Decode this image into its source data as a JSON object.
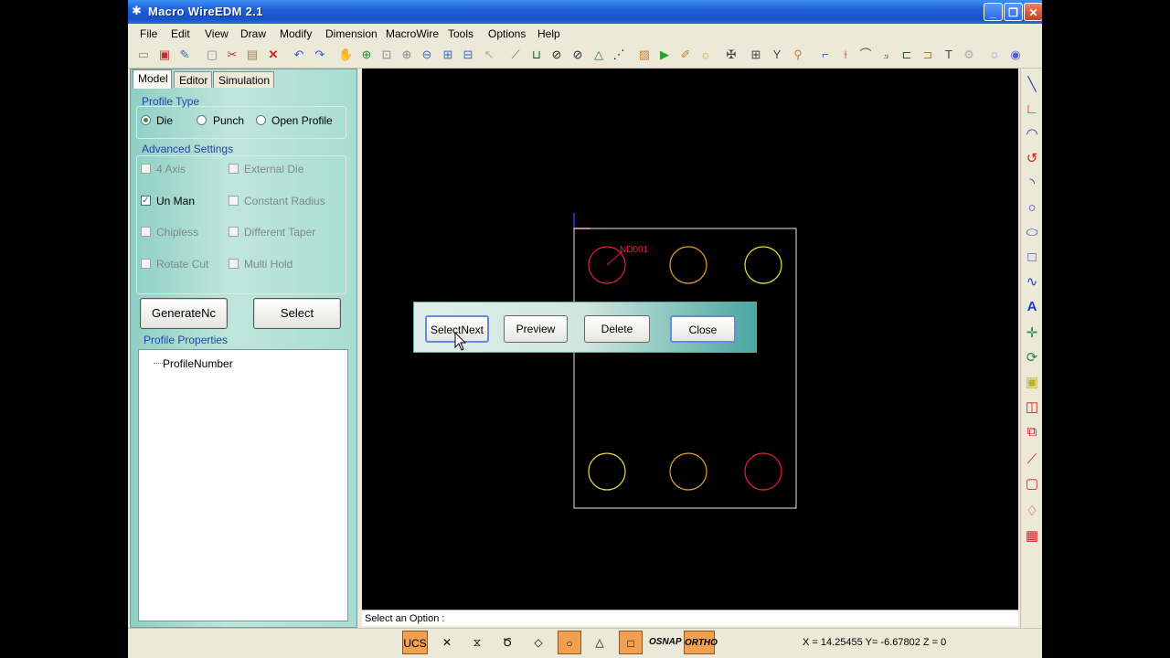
{
  "window": {
    "title": "Macro WireEDM 2.1"
  },
  "menu": [
    "File",
    "Edit",
    "View",
    "Draw",
    "Modify",
    "Dimension",
    "MacroWire",
    "Tools",
    "Options",
    "Help"
  ],
  "tabs": [
    "Model",
    "Editor",
    "Simulation"
  ],
  "profile_type": {
    "title": "Profile Type",
    "options": [
      "Die",
      "Punch",
      "Open Profile"
    ],
    "selected": "Die"
  },
  "advanced_settings": {
    "title": "Advanced Settings",
    "items": [
      {
        "label": "4 Axis",
        "checked": false
      },
      {
        "label": "External Die",
        "checked": false
      },
      {
        "label": "Un Man",
        "checked": true
      },
      {
        "label": "Constant Radius",
        "checked": false
      },
      {
        "label": "Chipless",
        "checked": false
      },
      {
        "label": "Different Taper",
        "checked": false
      },
      {
        "label": "Rotate Cut",
        "checked": false
      },
      {
        "label": "Multi Hold",
        "checked": false
      }
    ]
  },
  "buttons": {
    "generate_nc": "GenerateNc",
    "select": "Select"
  },
  "profile_properties": {
    "title": "Profile Properties",
    "items": [
      "ProfileNumber"
    ]
  },
  "canvas": {
    "label": "ND001"
  },
  "dialog": {
    "buttons": [
      "SelectNext",
      "Preview",
      "Delete",
      "Close"
    ]
  },
  "command_line": "Select an Option :",
  "status": {
    "ucs": "UCS",
    "osnap": "OSNAP",
    "ortho": "ORTHO",
    "coords": "X = 14.25455   Y= -6.67802   Z = 0"
  },
  "colors": {
    "circle_red": "#e0203a",
    "circle_yellow": "#f0e040",
    "circle_orange": "#e8a030",
    "dialog_teal": "#4aa6a0"
  }
}
